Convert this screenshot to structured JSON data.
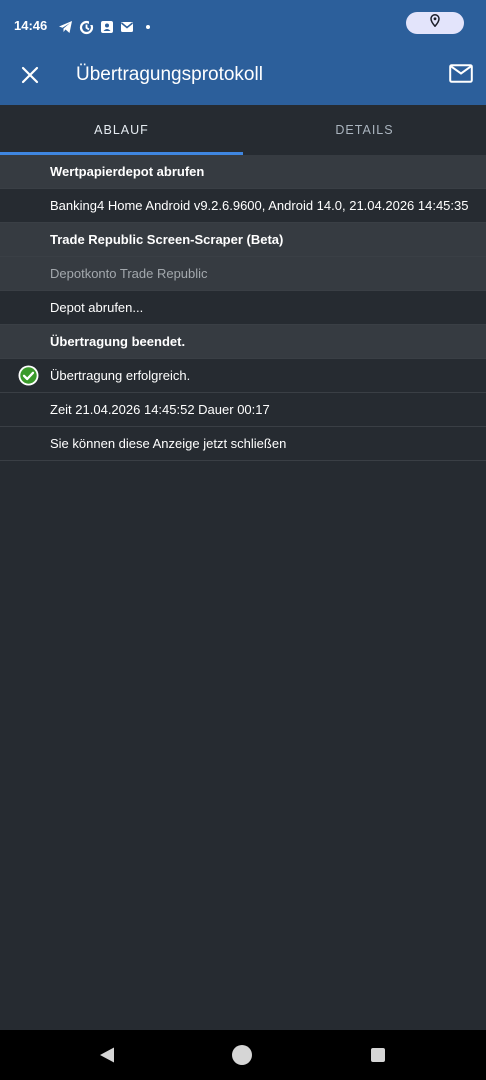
{
  "status_bar": {
    "time": "14:46",
    "icons": [
      "telegram-icon",
      "sync-icon",
      "contact-card-icon",
      "mail-icon",
      "notification-dot"
    ],
    "location_icon": "location-pin-icon"
  },
  "app_bar": {
    "title": "Übertragungsprotokoll",
    "close_icon": "close-icon",
    "mail_icon": "mail-icon",
    "background_color": "#2c5f9b"
  },
  "tabs": [
    {
      "label": "ABLAUF",
      "active": true
    },
    {
      "label": "DETAILS",
      "active": false
    }
  ],
  "log": {
    "rows": [
      {
        "text": "Wertpapierdepot abrufen",
        "style": "section"
      },
      {
        "text": "Banking4 Home Android v9.2.6.9600, Android 14.0, 21.04.2026 14:45:35",
        "style": "plain"
      },
      {
        "text": "Trade Republic Screen-Scraper (Beta)",
        "style": "section"
      },
      {
        "text": "Depotkonto Trade Republic",
        "style": "muted"
      },
      {
        "text": "Depot abrufen...",
        "style": "plain"
      },
      {
        "text": "Übertragung beendet.",
        "style": "section"
      },
      {
        "text": "Übertragung erfolgreich.",
        "style": "plain",
        "icon": "success-check-icon"
      },
      {
        "text": "Zeit 21.04.2026 14:45:52 Dauer 00:17",
        "style": "plain"
      },
      {
        "text": "Sie können diese Anzeige jetzt schließen",
        "style": "plain"
      }
    ]
  },
  "nav_bar": {
    "back_icon": "back-triangle-icon",
    "home_icon": "home-circle-icon",
    "recents_icon": "recents-square-icon"
  },
  "colors": {
    "accent": "#3f86e0",
    "success": "#3a9a2a",
    "background": "#262b31",
    "section_background": "#363b41"
  }
}
